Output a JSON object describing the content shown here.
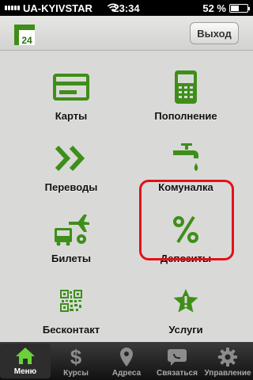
{
  "status": {
    "carrier": "UA-KYIVSTAR",
    "time": "23:34",
    "battery": "52 %",
    "battery_level": 0.52
  },
  "header": {
    "logo_text": "24",
    "exit_label": "Выход"
  },
  "menu": {
    "items": [
      {
        "label": "Карты",
        "icon": "card-icon"
      },
      {
        "label": "Пополнение",
        "icon": "phone-icon"
      },
      {
        "label": "Переводы",
        "icon": "double-chevron-icon"
      },
      {
        "label": "Комуналка",
        "icon": "faucet-icon"
      },
      {
        "label": "Билеты",
        "icon": "transport-icon"
      },
      {
        "label": "Депозиты",
        "icon": "percent-icon"
      },
      {
        "label": "Бесконтакт",
        "icon": "qr-code-icon"
      },
      {
        "label": "Услуги",
        "icon": "star-icon"
      }
    ]
  },
  "tabbar": {
    "tabs": [
      {
        "label": "Меню",
        "icon": "home-icon",
        "active": true
      },
      {
        "label": "Курсы",
        "icon": "dollar-icon",
        "active": false
      },
      {
        "label": "Адреса",
        "icon": "map-pin-icon",
        "active": false
      },
      {
        "label": "Связаться",
        "icon": "chat-icon",
        "active": false
      },
      {
        "label": "Управление",
        "icon": "gear-icon",
        "active": false
      }
    ]
  },
  "colors": {
    "accent_green": "#3f8e1a",
    "highlight_red": "#e3101a"
  }
}
